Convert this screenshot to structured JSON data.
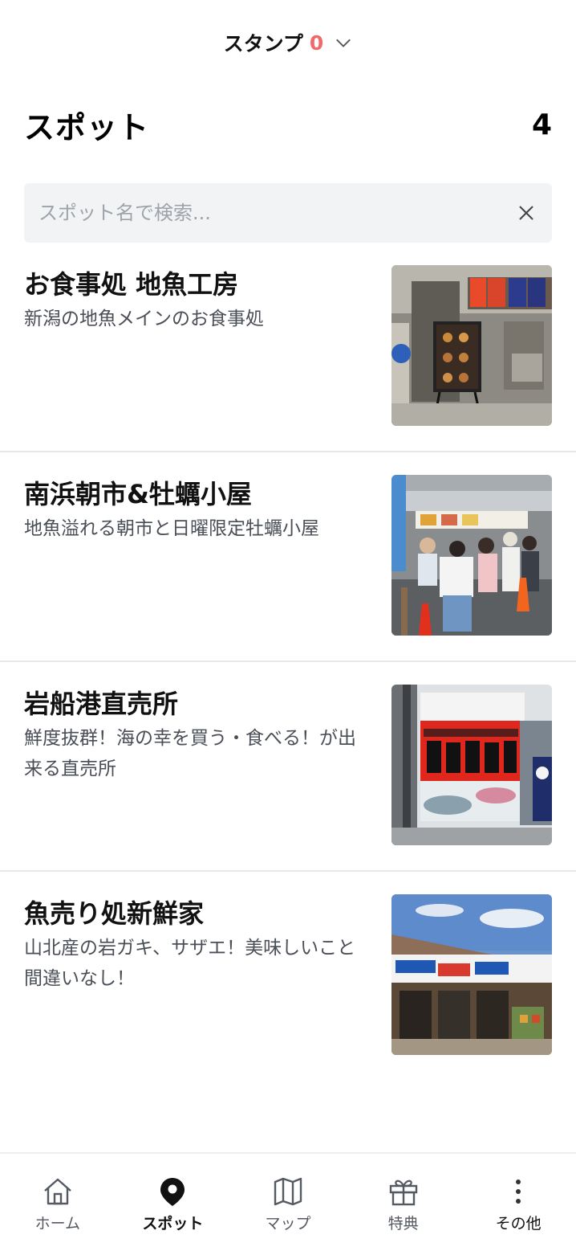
{
  "header": {
    "stamp_label": "スタンプ",
    "stamp_count": "0",
    "stamp_count_color": "#f06a6a"
  },
  "page": {
    "title": "スポット",
    "count": "4"
  },
  "search": {
    "placeholder": "スポット名で検索...",
    "value": ""
  },
  "spots": [
    {
      "name": "お食事処 地魚工房",
      "description": "新潟の地魚メインのお食事処",
      "image": "photo-restaurant-storefront"
    },
    {
      "name": "南浜朝市&牡蠣小屋",
      "description": "地魚溢れる朝市と日曜限定牡蠣小屋",
      "image": "photo-morning-market-crowd"
    },
    {
      "name": "岩船港直売所",
      "description": "鮮度抜群！海の幸を買う・食べる！が出来る直売所",
      "image": "photo-harbor-shop-banner"
    },
    {
      "name": "魚売り処新鮮家",
      "description": "山北産の岩ガキ、サザエ！美味しいこと間違いなし！",
      "image": "photo-fish-shop-exterior"
    }
  ],
  "nav": {
    "items": [
      {
        "label": "ホーム",
        "icon": "home-icon"
      },
      {
        "label": "スポット",
        "icon": "map-pin-icon",
        "active": true
      },
      {
        "label": "マップ",
        "icon": "map-icon"
      },
      {
        "label": "特典",
        "icon": "gift-icon"
      },
      {
        "label": "その他",
        "icon": "more-vertical-icon"
      }
    ]
  }
}
